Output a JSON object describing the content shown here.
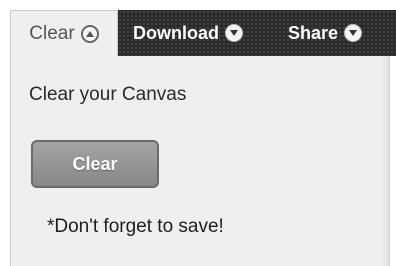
{
  "tabs": {
    "clear": {
      "label": "Clear",
      "icon": "chevron-up-icon",
      "active": true
    },
    "download": {
      "label": "Download",
      "icon": "chevron-down-icon"
    },
    "share": {
      "label": "Share",
      "icon": "chevron-down-icon"
    }
  },
  "panel": {
    "title": "Clear your Canvas",
    "button_label": "Clear",
    "note": "*Don't forget to save!"
  },
  "colors": {
    "dark_bar": "#2a2a2a",
    "panel_bg": "#efefef",
    "button_bg": "#999999"
  }
}
